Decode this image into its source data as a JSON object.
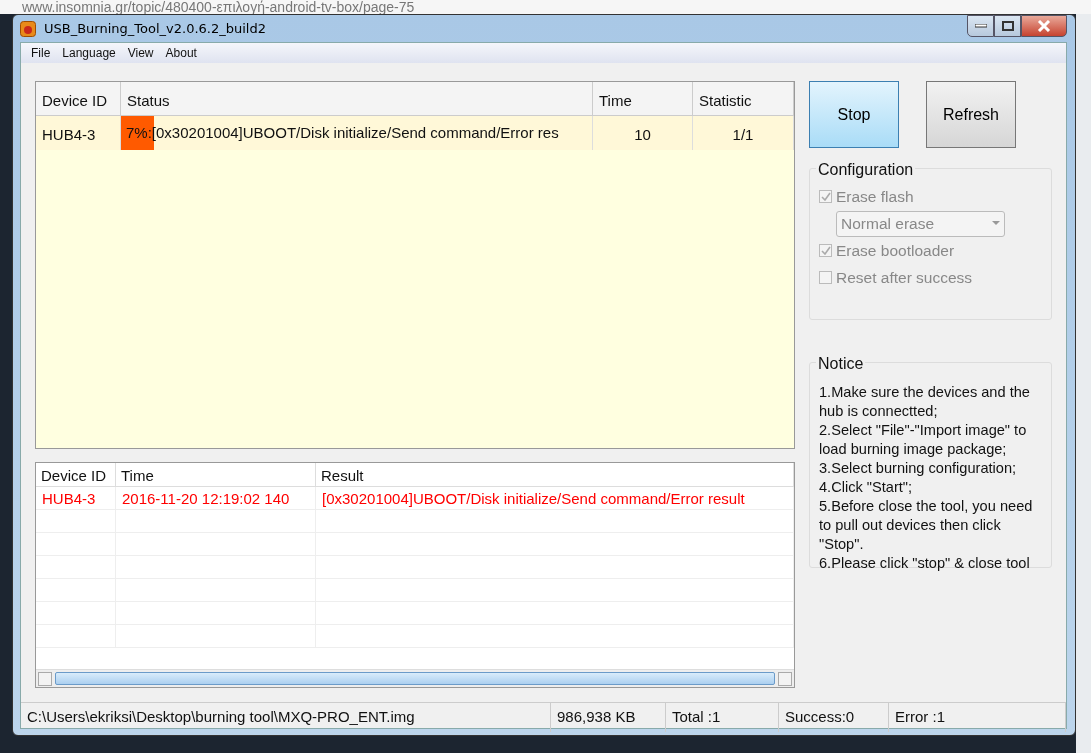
{
  "browser": {
    "address": "www.insomnia.gr/topic/480400-επιλογή-android-tv-box/page-75"
  },
  "window": {
    "title": "USB_Burning_Tool_v2.0.6.2_build2"
  },
  "menu": [
    "File",
    "Language",
    "View",
    "About"
  ],
  "device_table": {
    "columns": [
      "Device ID",
      "Status",
      "Time",
      "Statistic"
    ],
    "rows": [
      {
        "device_id": "HUB4-3",
        "percent": "7%",
        "level": 0.07,
        "status": ":[0x30201004]UBOOT/Disk initialize/Send command/Error res",
        "time": "10",
        "statistic": "1/1"
      }
    ]
  },
  "buttons": [
    {
      "label": "Stop",
      "highlighted": true
    },
    {
      "label": "Refresh",
      "highlighted": false
    }
  ],
  "configuration": {
    "title": "Configuration",
    "options": [
      {
        "kind": "checkbox",
        "label": "Erase flash",
        "checked": true,
        "disabled": true
      },
      {
        "kind": "dropdown",
        "value": "Normal erase",
        "disabled": true
      },
      {
        "kind": "checkbox",
        "label": "Erase bootloader",
        "checked": true,
        "disabled": true
      },
      {
        "kind": "checkbox",
        "label": "Reset after success",
        "checked": false,
        "disabled": true
      }
    ]
  },
  "log_table": {
    "columns": [
      "Device ID",
      "Time",
      "Result"
    ],
    "rows": [
      {
        "device_id": "HUB4-3",
        "time": "2016-11-20 12:19:02 140",
        "result": "[0x30201004]UBOOT/Disk initialize/Send command/Error result",
        "error": true
      }
    ]
  },
  "notice": {
    "title": "Notice",
    "lines": [
      "1.Make sure the devices and the hub is connectted;",
      "2.Select \"File\"-\"Import image\" to load burning image package;",
      "3.Select burning configuration;",
      "4.Click \"Start\";",
      "5.Before close the tool, you need to pull out devices then click \"Stop\".",
      "6.Please click \"stop\" & close tool"
    ]
  },
  "status_bar": [
    "C:\\Users\\ekriksi\\Desktop\\burning tool\\MXQ-PRO_ENT.img",
    "986,938 KB",
    "Total :1",
    "Success:0",
    "Error :1"
  ]
}
